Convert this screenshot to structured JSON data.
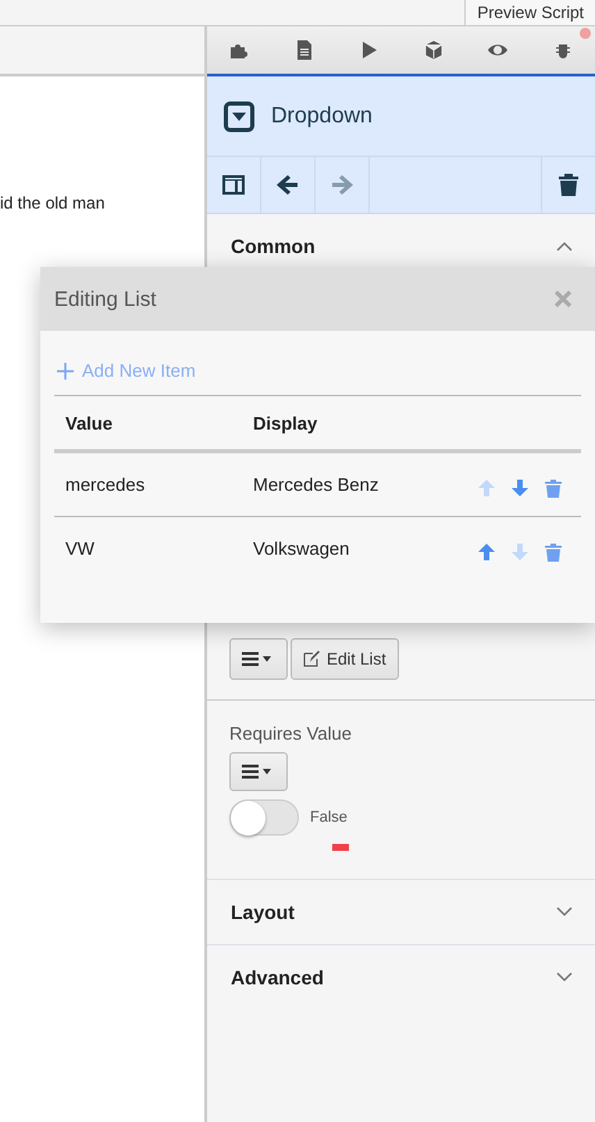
{
  "top_bar": {
    "button": "Preview Script"
  },
  "editor": {
    "text": "id the old man"
  },
  "panel": {
    "toolbar_icons": [
      {
        "kind": "puzzle"
      },
      {
        "kind": "document"
      },
      {
        "kind": "play"
      },
      {
        "kind": "cube"
      },
      {
        "kind": "eye"
      },
      {
        "kind": "bug",
        "badge": true
      }
    ],
    "component": {
      "title": "Dropdown"
    },
    "actions": [
      {
        "kind": "layout",
        "disabled": false
      },
      {
        "kind": "back",
        "disabled": false
      },
      {
        "kind": "forward",
        "disabled": true
      },
      {
        "kind": "delete",
        "disabled": false
      }
    ],
    "common": {
      "title": "Common",
      "expanded": true,
      "edit_list_button": "Edit List"
    },
    "requires_value": {
      "label": "Requires Value",
      "on": false,
      "reading": "False"
    },
    "sections": [
      {
        "title": "Layout",
        "expanded": false
      },
      {
        "title": "Advanced",
        "expanded": false
      }
    ]
  },
  "dialog": {
    "title": "Editing List",
    "add_link": "Add New Item",
    "columns": [
      "Value",
      "Display"
    ],
    "rows": [
      {
        "value": "mercedes",
        "display": "Mercedes Benz",
        "up_disabled": true,
        "down_disabled": false
      },
      {
        "value": "VW",
        "display": "Volkswagen",
        "up_disabled": false,
        "down_disabled": true
      }
    ]
  }
}
